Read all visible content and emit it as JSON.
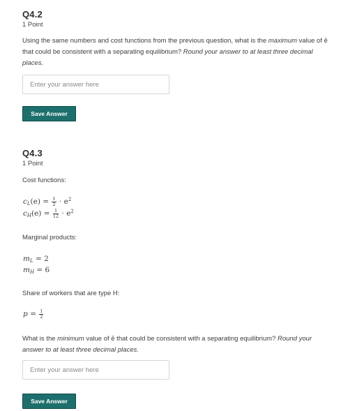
{
  "q42": {
    "title": "Q4.2",
    "points": "1 Point",
    "prompt_a": "Using the same numbers and cost functions from the previous question, what is the ",
    "prompt_em1": "maximum",
    "prompt_b": " value of ē that could be consistent with a separating equilibrium? ",
    "prompt_em2": "Round your answer to at least three decimal places.",
    "input_placeholder": "Enter your answer here",
    "save_label": "Save Answer"
  },
  "q43": {
    "title": "Q4.3",
    "points": "1 Point",
    "cost_label": "Cost functions:",
    "cost_L": {
      "lhs": "c",
      "sub": "L",
      "arg": "(e) = ",
      "num": "1",
      "den": "2",
      "rhs": "· e",
      "exp": "2"
    },
    "cost_H": {
      "lhs": "c",
      "sub": "H",
      "arg": "(e) = ",
      "num": "1",
      "den": "12",
      "rhs": "· e",
      "exp": "2"
    },
    "marginal_label": "Marginal products:",
    "m_L": {
      "lhs": "m",
      "sub": "L",
      "rhs": " = 2"
    },
    "m_H": {
      "lhs": "m",
      "sub": "H",
      "rhs": " = 6"
    },
    "share_label": "Share of workers that are type H:",
    "p": {
      "lhs": "p",
      "eq": " = ",
      "num": "1",
      "den": "2"
    },
    "prompt_a": "What is the ",
    "prompt_em1": "minimum",
    "prompt_b": " value of ē that could be consistent with a separating equilibrium? ",
    "prompt_em2": "Round your answer to at least three decimal places.",
    "input_placeholder": "Enter your answer here",
    "save_label": "Save Answer"
  }
}
